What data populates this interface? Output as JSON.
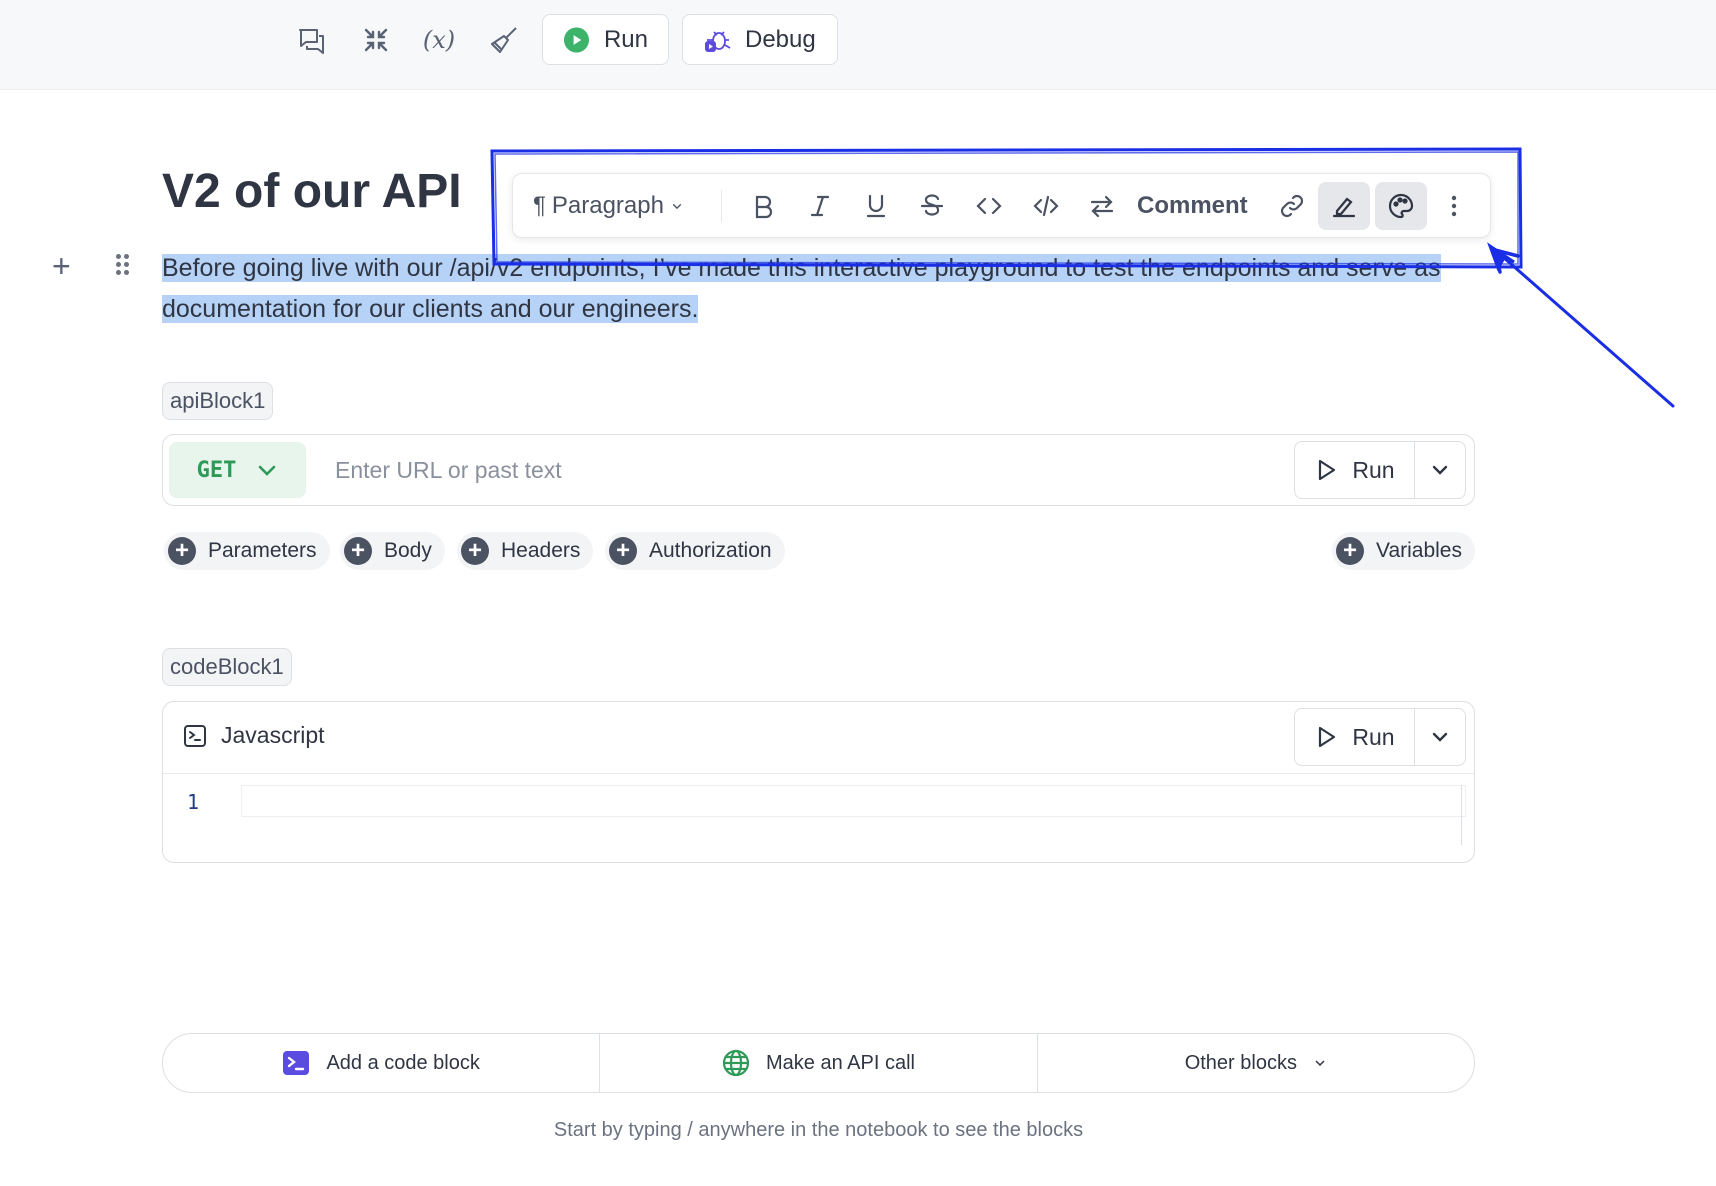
{
  "toolbar": {
    "icons": [
      "chat-icon",
      "collapse-icon",
      "variables-icon",
      "clear-icon"
    ],
    "variables_glyph": "(x)",
    "run_label": "Run",
    "debug_label": "Debug"
  },
  "document": {
    "title": "V2 of our API",
    "paragraph": "Before going live with our /api/v2 endpoints, I’ve made this interactive playground to test the endpoints and serve as documentation for our clients and our engineers."
  },
  "format_toolbar": {
    "block_type": "Paragraph",
    "comment_label": "Comment",
    "buttons": [
      "bold-icon",
      "italic-icon",
      "underline-icon",
      "strikethrough-icon",
      "code-icon",
      "code-block-icon",
      "swap-icon",
      "link-icon",
      "highlight-icon",
      "palette-icon",
      "more-icon"
    ]
  },
  "api_block": {
    "name": "apiBlock1",
    "method": "GET",
    "url_placeholder": "Enter URL or past text",
    "url_value": "",
    "run_label": "Run",
    "tabs": [
      "Parameters",
      "Body",
      "Headers",
      "Authorization"
    ],
    "variables_label": "Variables"
  },
  "code_block": {
    "name": "codeBlock1",
    "language": "Javascript",
    "run_label": "Run",
    "line_numbers": [
      "1"
    ]
  },
  "add_bar": {
    "code_block_label": "Add a code block",
    "api_call_label": "Make an API call",
    "other_label": "Other blocks"
  },
  "hint": "Start by typing / anywhere in the notebook to see the blocks",
  "colors": {
    "accent_green": "#2f9a57",
    "debug_purple": "#5b4be0",
    "selection_blue": "#b6d3f7",
    "annotation_blue": "#1a2ee6"
  }
}
